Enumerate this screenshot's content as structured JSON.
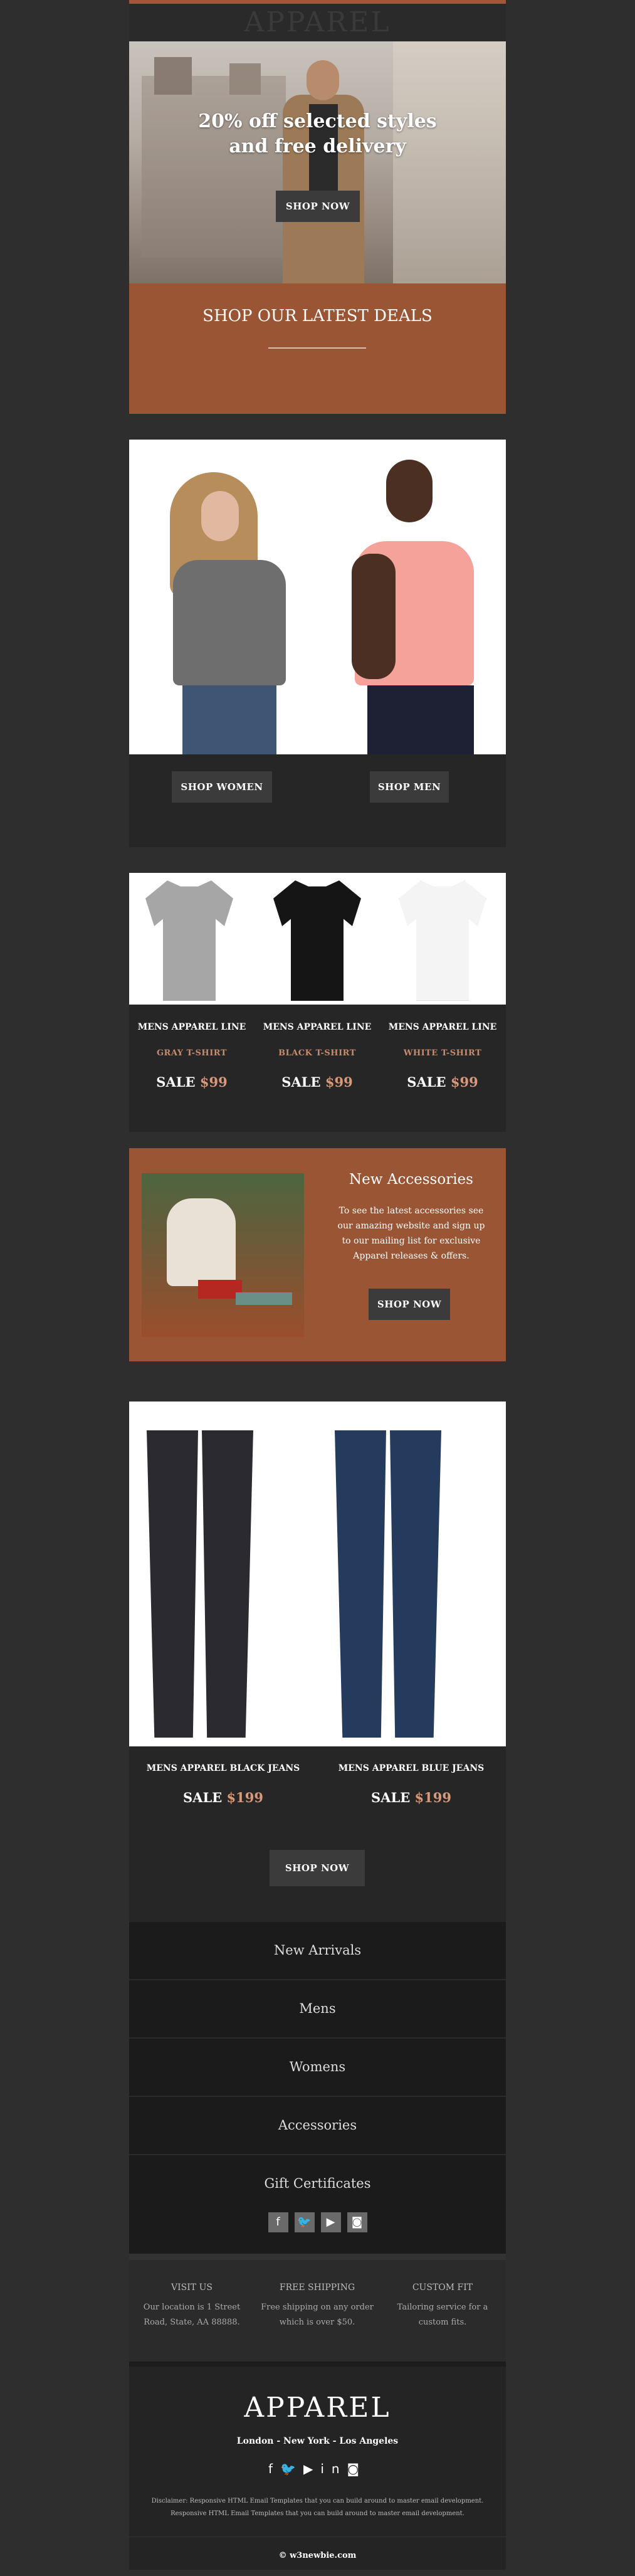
{
  "brand": {
    "name": "APPAREL"
  },
  "hero": {
    "headline_1": "20% off selected styles",
    "headline_2": "and free delivery",
    "button": "SHOP NOW"
  },
  "deals": {
    "title": "SHOP OUR LATEST DEALS"
  },
  "models": {
    "women_button": "SHOP WOMEN",
    "men_button": "SHOP MEN"
  },
  "tshirts": [
    {
      "line": "MENS APPAREL LINE",
      "color_name": "GRAY T-SHIRT",
      "sale": "SALE",
      "price": "$99",
      "swatch": "#a6a6a6"
    },
    {
      "line": "MENS APPAREL LINE",
      "color_name": "BLACK T-SHIRT",
      "sale": "SALE",
      "price": "$99",
      "swatch": "#151515"
    },
    {
      "line": "MENS APPAREL LINE",
      "color_name": "WHITE T-SHIRT",
      "sale": "SALE",
      "price": "$99",
      "swatch": "#f4f4f4"
    }
  ],
  "accessories": {
    "title": "New Accessories",
    "body": "To see the latest accessories see our amazing website and sign up to our mailing list for exclusive Apparel releases & offers.",
    "button": "SHOP NOW"
  },
  "jeans": [
    {
      "line": "MENS APPAREL BLACK JEANS",
      "sale": "SALE",
      "price": "$199",
      "swatch": "#2a2a30"
    },
    {
      "line": "MENS APPAREL BLUE JEANS",
      "sale": "SALE",
      "price": "$199",
      "swatch": "#253b5e"
    }
  ],
  "jeans_button": "SHOP NOW",
  "nav": [
    "New Arrivals",
    "Mens",
    "Womens",
    "Accessories",
    "Gift Certificates"
  ],
  "social_icons": [
    "facebook-icon",
    "twitter-icon",
    "youtube-icon",
    "instagram-icon"
  ],
  "info": [
    {
      "heading": "VISIT US",
      "text": "Our location is 1 Street Road, State, AA 88888."
    },
    {
      "heading": "FREE SHIPPING",
      "text": "Free shipping on any order which is over $50."
    },
    {
      "heading": "CUSTOM FIT",
      "text": "Tailoring service for a custom fits."
    }
  ],
  "footer": {
    "brand": "APPAREL",
    "cities": "London - New York - Los Angeles",
    "disclaimer": "Disclaimer: Responsive HTML Email Templates that you can build around to master email development. Responsive HTML Email Templates that you can build around to master email development.",
    "copyright": "© w3newbie.com"
  },
  "colors": {
    "accent": "#9a5534",
    "price": "#d99979",
    "button": "#3b3b3b"
  }
}
